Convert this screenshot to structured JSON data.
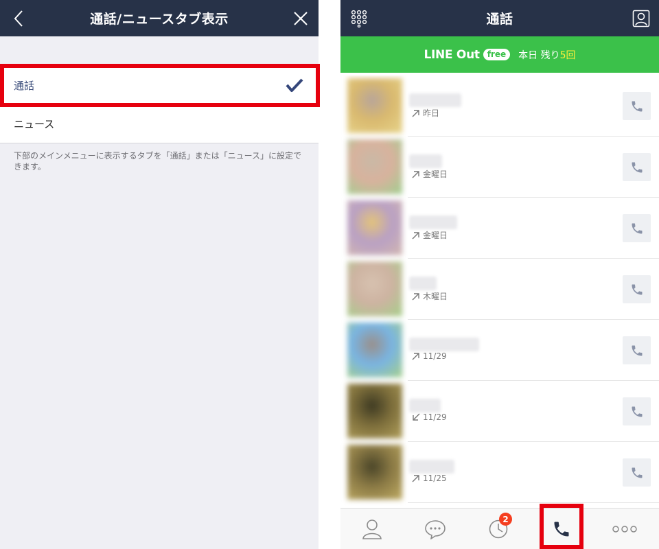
{
  "left": {
    "header": {
      "title": "通話/ニュースタブ表示"
    },
    "options": [
      {
        "label": "通話",
        "selected": true
      },
      {
        "label": "ニュース",
        "selected": false
      }
    ],
    "description": "下部のメインメニューに表示するタブを「通話」または「ニュース」に設定できます。"
  },
  "right": {
    "header": {
      "title": "通話"
    },
    "banner": {
      "brand": "LINE Out",
      "free_badge": "free",
      "remaining_prefix": "本日 残り",
      "remaining_count": "5回"
    },
    "calls": [
      {
        "direction": "outgoing",
        "date": "昨日",
        "avatar_colors": [
          "#d9b96f",
          "#b8a59a",
          "#e7d48a"
        ]
      },
      {
        "direction": "outgoing",
        "date": "金曜日",
        "avatar_colors": [
          "#d8b29d",
          "#c9b9a6",
          "#9fcf8f"
        ]
      },
      {
        "direction": "outgoing",
        "date": "金曜日",
        "avatar_colors": [
          "#b9a0c4",
          "#e3c47a",
          "#d2b7b0"
        ]
      },
      {
        "direction": "outgoing",
        "date": "木曜日",
        "avatar_colors": [
          "#cdb3a1",
          "#d7c2b0",
          "#a6cf8a"
        ]
      },
      {
        "direction": "outgoing",
        "date": "11/29",
        "avatar_colors": [
          "#79b4e2",
          "#9a8f8a",
          "#a6d08a"
        ]
      },
      {
        "direction": "incoming",
        "date": "11/29",
        "avatar_colors": [
          "#7d6e3b",
          "#3e3a22",
          "#b2a05c"
        ]
      },
      {
        "direction": "outgoing",
        "date": "11/25",
        "avatar_colors": [
          "#8b7a45",
          "#4a4528",
          "#c0ac64"
        ]
      }
    ],
    "tabbar": {
      "timeline_badge": "2",
      "active": "call"
    }
  },
  "colors": {
    "navy": "#273248",
    "line_green": "#3bc14a",
    "highlight_red": "#e6000e",
    "badge_red": "#f53e1f"
  }
}
